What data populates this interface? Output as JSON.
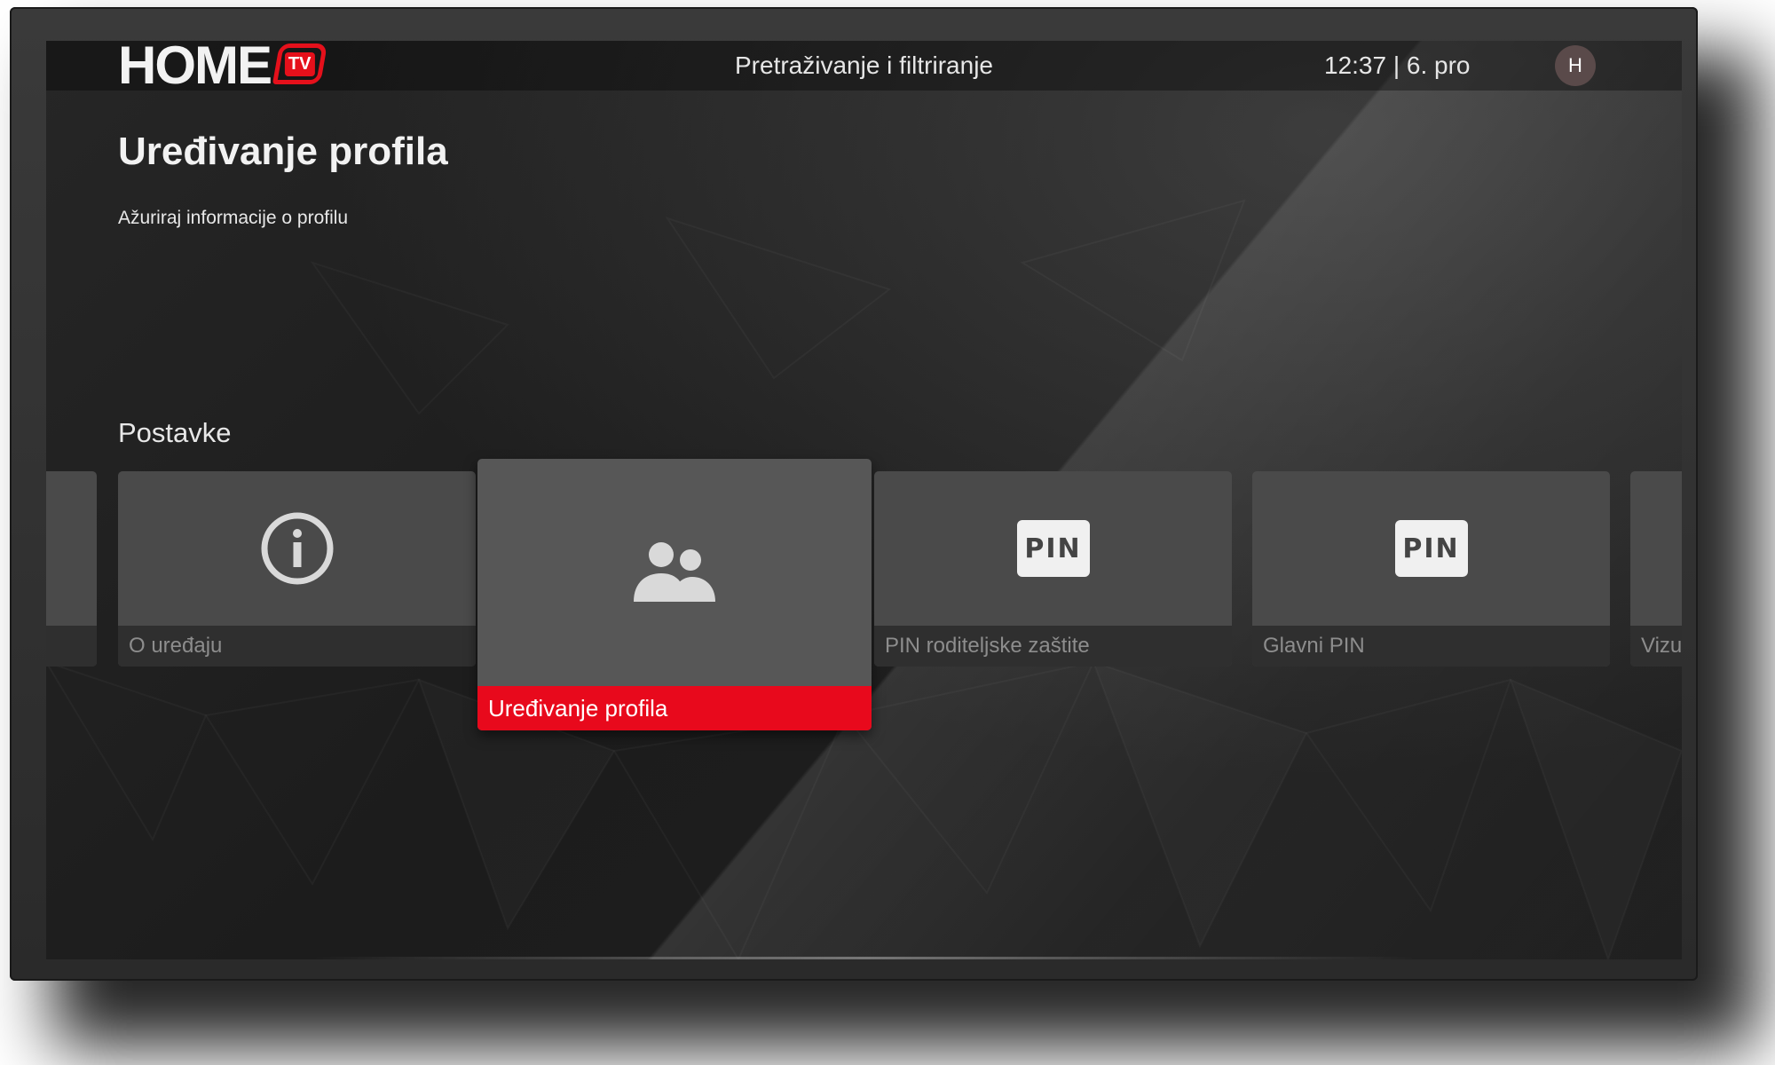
{
  "header": {
    "logo_word": "HOME",
    "logo_badge": "TV",
    "center_title": "Pretraživanje i filtriranje",
    "clock": "12:37 | 6. pro",
    "avatar_initial": "H"
  },
  "page": {
    "title": "Uređivanje profila",
    "subtitle": "Ažuriraj informacije o profilu"
  },
  "settings": {
    "section_title": "Postavke",
    "cards": [
      {
        "label": "",
        "icon": "partial-card"
      },
      {
        "label": "O uređaju",
        "icon": "info-icon"
      },
      {
        "label": "Uređivanje profila",
        "icon": "people-icon",
        "focused": true
      },
      {
        "label": "PIN roditeljske zaštite",
        "icon": "pin-icon",
        "icon_text": "PIN"
      },
      {
        "label": "Glavni PIN",
        "icon": "pin-icon",
        "icon_text": "PIN"
      },
      {
        "label": "Vizu",
        "icon": "partial-card"
      }
    ]
  },
  "colors": {
    "accent": "#e8091c",
    "card": "#4a4a4a",
    "background": "#1b1b1b"
  }
}
